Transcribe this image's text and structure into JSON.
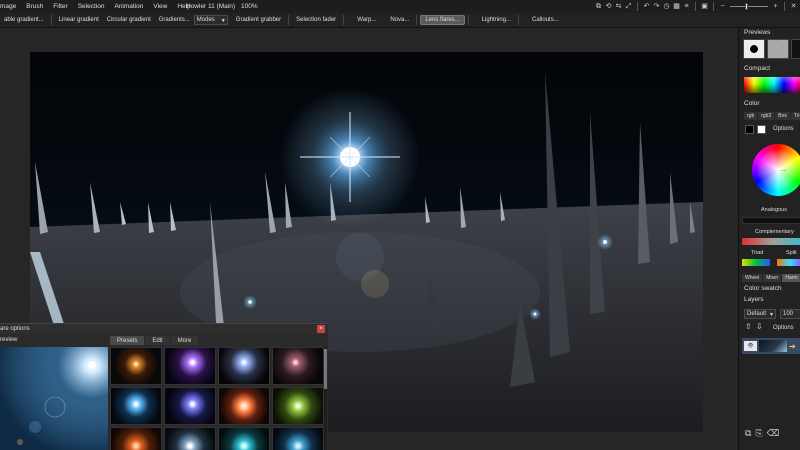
{
  "menubar": {
    "items": [
      "mage",
      "Brush",
      "Filter",
      "Selection",
      "Animation",
      "View",
      "Help"
    ],
    "title": "Howler 11 (Main)",
    "zoom": "100%"
  },
  "toolbar": {
    "buttons": [
      "able gradient...",
      "Linear gradient",
      "Circular gradient",
      "Gradients...",
      "Gradient grabber",
      "Selection fader",
      "Warp...",
      "Nova...",
      "Lens flares...",
      "Lightning...",
      "Callouts..."
    ],
    "modes_label": "Modes",
    "active": "Lens flares..."
  },
  "dialog": {
    "title": "are options",
    "preview_label": "review",
    "tabs": [
      "Presets",
      "Edit",
      "More"
    ],
    "active_tab": "Presets",
    "close_glyph": "×"
  },
  "panel": {
    "previews_title": "Previews",
    "compact_title": "Compact",
    "color_title": "Color",
    "color_tabs": [
      "rgb",
      "rgb2",
      "Box",
      "Tri"
    ],
    "options_label": "Options",
    "analogous_label": "Analogous",
    "complementary_label": "Complementary",
    "triad_label": "Triad",
    "split_label": "Split",
    "mini_tabs": [
      "Wheel",
      "Mixer",
      "Harm"
    ],
    "active_mini_tab": "Harm",
    "swatch_title": "Color swatch",
    "layers_title": "Layers",
    "layer_mode": "Default",
    "layer_opacity": "100",
    "layer_options": "Options",
    "layer_eye": "👁"
  },
  "colors": {
    "accent": "#4a4a4a",
    "close": "#c94343",
    "layer_selected": "#3a4a66"
  }
}
